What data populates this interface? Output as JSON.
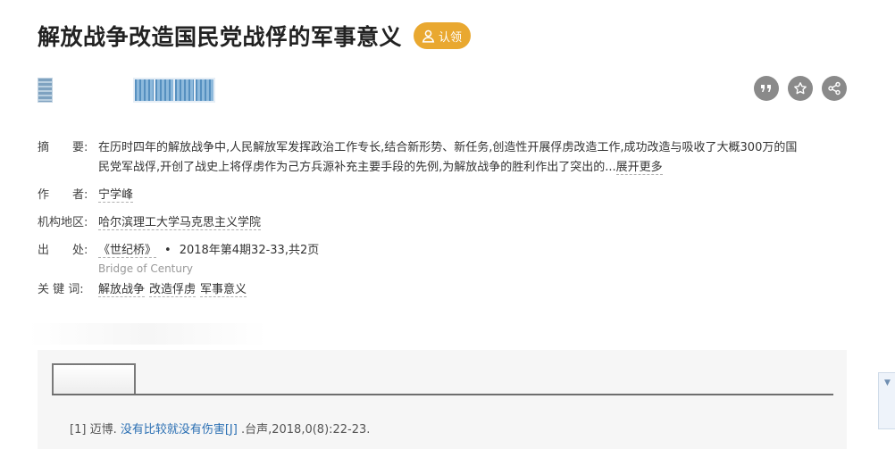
{
  "title": "解放战争改造国民党战俘的军事意义",
  "claim_badge": {
    "label": "认领",
    "icon": "person-icon",
    "color": "#e9a830"
  },
  "actions": [
    {
      "name": "cite-button",
      "icon": "quote-icon"
    },
    {
      "name": "favorite-button",
      "icon": "star-icon"
    },
    {
      "name": "share-button",
      "icon": "share-icon"
    }
  ],
  "meta": {
    "abstract": {
      "label": "摘　　要:",
      "line1": "在历时四年的解放战争中,人民解放军发挥政治工作专长,结合新形势、新任务,创造性开展俘虏改造工作,成功改造与吸收了大概300万的国",
      "line2": "民党军战俘,开创了战史上将俘虏作为己方兵源补充主要手段的先例,为解放战争的胜利作出了突出的...",
      "expand": "展开更多"
    },
    "author": {
      "label": "作　　者:",
      "value": "宁学峰"
    },
    "org": {
      "label": "机构地区:",
      "value": "哈尔滨理工大学马克思主义学院"
    },
    "source": {
      "label": "出　　处:",
      "journal": "《世纪桥》",
      "separator": "•",
      "issue": "2018年第4期32-33,共2页",
      "english": "Bridge of Century"
    },
    "keywords": {
      "label": "关  键  词:",
      "items": [
        "解放战争",
        "改造俘虏",
        "军事意义"
      ]
    }
  },
  "references": [
    {
      "index": "[1]",
      "author": "迈博.",
      "title": "没有比较就没有伤害[J]",
      "rest": ".台声,2018,0(8):22-23."
    }
  ],
  "side_widget": {
    "icon": "chevron-down-icon",
    "glyph": "▼"
  }
}
